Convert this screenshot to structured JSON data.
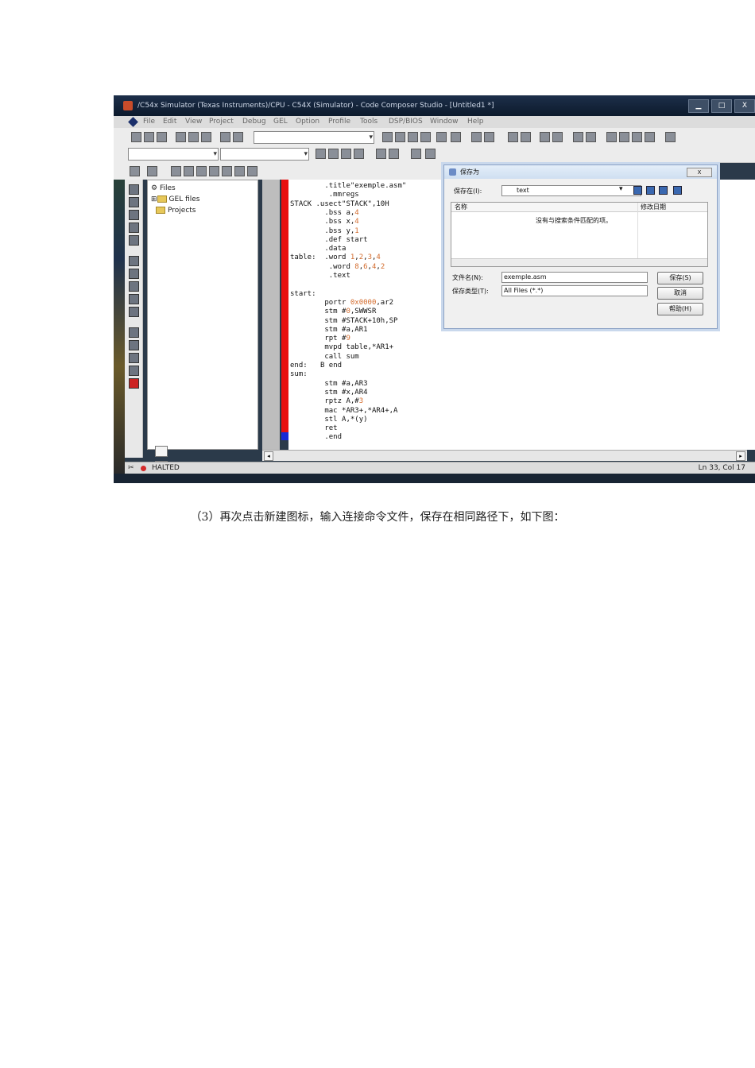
{
  "window": {
    "title": "/C54x Simulator (Texas Instruments)/CPU - C54X (Simulator) - Code Composer Studio - [Untitled1 *]",
    "controls": [
      "▁",
      "□",
      "X"
    ]
  },
  "menu": [
    "File",
    "Edit",
    "View",
    "Project",
    "Debug",
    "GEL",
    "Option",
    "Profile",
    "Tools",
    "DSP/BIOS",
    "Window",
    "Help"
  ],
  "project_tree": {
    "root": "Files",
    "children": [
      "GEL files",
      "Projects"
    ]
  },
  "editor_lines": [
    {
      "label": "",
      "code": "        .title\"exemple.asm\""
    },
    {
      "label": "",
      "code": "         .mmregs"
    },
    {
      "label": "STACK",
      "code": " .usect\"STACK\",10H"
    },
    {
      "label": "",
      "code": "        .bss a,4"
    },
    {
      "label": "",
      "code": "        .bss x,4"
    },
    {
      "label": "",
      "code": "        .bss y,1"
    },
    {
      "label": "",
      "code": "        .def start"
    },
    {
      "label": "",
      "code": "        .data"
    },
    {
      "label": "table:",
      "code": "  .word 1,2,3,4"
    },
    {
      "label": "",
      "code": "         .word 8,6,4,2"
    },
    {
      "label": "",
      "code": "         .text"
    },
    {
      "label": "",
      "code": ""
    },
    {
      "label": "start:",
      "code": ""
    },
    {
      "label": "",
      "code": "        portr 0x0000,ar2"
    },
    {
      "label": "",
      "code": "        stm #0,SWWSR"
    },
    {
      "label": "",
      "code": "        stm #STACK+10h,SP"
    },
    {
      "label": "",
      "code": "        stm #a,AR1"
    },
    {
      "label": "",
      "code": "        rpt #9"
    },
    {
      "label": "",
      "code": "        mvpd table,*AR1+"
    },
    {
      "label": "",
      "code": "        call sum"
    },
    {
      "label": "end:",
      "code": "   B end"
    },
    {
      "label": "sum:",
      "code": ""
    },
    {
      "label": "",
      "code": "        stm #a,AR3"
    },
    {
      "label": "",
      "code": "        stm #x,AR4"
    },
    {
      "label": "",
      "code": "        rptz A,#3"
    },
    {
      "label": "",
      "code": "        mac *AR3+,*AR4+,A"
    },
    {
      "label": "",
      "code": "        stl A,*(y)"
    },
    {
      "label": "",
      "code": "        ret"
    },
    {
      "label": "",
      "code": "        .end"
    }
  ],
  "status": {
    "state": "HALTED",
    "position": "Ln 33, Col 17"
  },
  "save_dialog": {
    "title": "保存为",
    "save_in_label": "保存在(I):",
    "save_in_value": "text",
    "col_name": "名称",
    "col_modified": "修改日期",
    "empty_message": "没有与搜索条件匹配的项。",
    "filename_label": "文件名(N):",
    "filename_value": "exemple.asm",
    "filetype_label": "保存类型(T):",
    "filetype_value": "All Files (*.*)",
    "save_button": "保存(S)",
    "cancel_button": "取消",
    "help_button": "帮助(H)",
    "close_button": "X"
  },
  "caption": "（3）再次点击新建图标，输入连接命令文件，保存在相同路径下，如下图："
}
